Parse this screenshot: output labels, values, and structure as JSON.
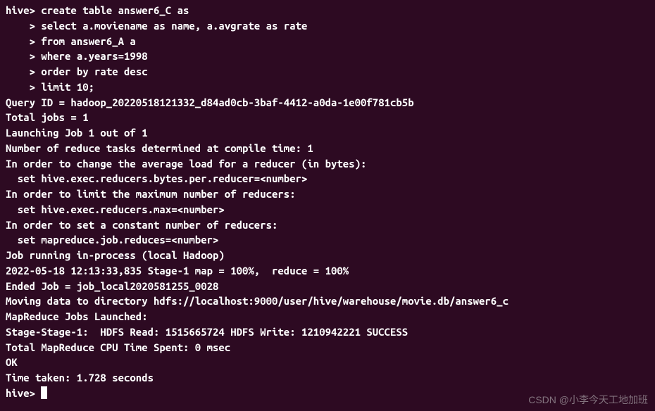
{
  "prompt_main": "hive>",
  "prompt_cont": "    >",
  "sql": {
    "l1": " create table answer6_C as",
    "l2": " select a.moviename as name, a.avgrate as rate",
    "l3": " from answer6_A a",
    "l4": " where a.years=1998",
    "l5": " order by rate desc",
    "l6": " limit 10;"
  },
  "out": {
    "l1": "Query ID = hadoop_20220518121332_d84ad0cb-3baf-4412-a0da-1e00f781cb5b",
    "l2": "Total jobs = 1",
    "l3": "Launching Job 1 out of 1",
    "l4": "Number of reduce tasks determined at compile time: 1",
    "l5": "In order to change the average load for a reducer (in bytes):",
    "l6": "  set hive.exec.reducers.bytes.per.reducer=<number>",
    "l7": "In order to limit the maximum number of reducers:",
    "l8": "  set hive.exec.reducers.max=<number>",
    "l9": "In order to set a constant number of reducers:",
    "l10": "  set mapreduce.job.reduces=<number>",
    "l11": "Job running in-process (local Hadoop)",
    "l12": "2022-05-18 12:13:33,835 Stage-1 map = 100%,  reduce = 100%",
    "l13": "Ended Job = job_local2020581255_0028",
    "l14": "Moving data to directory hdfs://localhost:9000/user/hive/warehouse/movie.db/answer6_c",
    "l15": "MapReduce Jobs Launched:",
    "l16": "Stage-Stage-1:  HDFS Read: 1515665724 HDFS Write: 1210942221 SUCCESS",
    "l17": "Total MapReduce CPU Time Spent: 0 msec",
    "l18": "OK",
    "l19": "Time taken: 1.728 seconds"
  },
  "prompt_end": "hive> ",
  "watermark": "CSDN @小李今天工地加班"
}
